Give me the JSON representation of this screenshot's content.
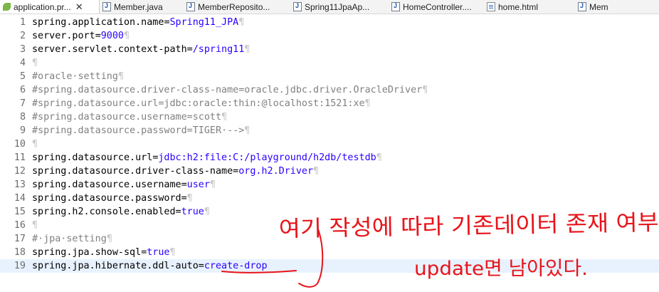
{
  "tabs": [
    {
      "label": "application.pr...",
      "icon": "properties-file-icon",
      "active": true,
      "close": "✕"
    },
    {
      "label": "Member.java",
      "icon": "java-file-icon"
    },
    {
      "label": "MemberReposito...",
      "icon": "java-file-icon"
    },
    {
      "label": "Spring11JpaAp...",
      "icon": "java-file-icon"
    },
    {
      "label": "HomeController....",
      "icon": "java-file-icon"
    },
    {
      "label": "home.html",
      "icon": "html-file-icon"
    },
    {
      "label": "Mem",
      "icon": "java-file-icon"
    }
  ],
  "lines": [
    {
      "n": "1",
      "parts": [
        {
          "t": "spring.application.name",
          "s": "k"
        },
        {
          "t": "=",
          "s": "eq"
        },
        {
          "t": "Spring11_JPA",
          "s": "v"
        },
        {
          "t": "¶",
          "s": "pil"
        }
      ]
    },
    {
      "n": "2",
      "parts": [
        {
          "t": "server.port",
          "s": "k"
        },
        {
          "t": "=",
          "s": "eq"
        },
        {
          "t": "9000",
          "s": "v"
        },
        {
          "t": "¶",
          "s": "pil"
        }
      ]
    },
    {
      "n": "3",
      "parts": [
        {
          "t": "server.servlet.context-path",
          "s": "k"
        },
        {
          "t": "=",
          "s": "eq"
        },
        {
          "t": "/spring11",
          "s": "v"
        },
        {
          "t": "¶",
          "s": "pil"
        }
      ]
    },
    {
      "n": "4",
      "parts": [
        {
          "t": "¶",
          "s": "pil"
        }
      ]
    },
    {
      "n": "5",
      "parts": [
        {
          "t": "#oracle·setting",
          "s": "c"
        },
        {
          "t": "¶",
          "s": "pil"
        }
      ]
    },
    {
      "n": "6",
      "parts": [
        {
          "t": "#spring.datasource.driver-class-name=oracle.jdbc.driver.OracleDriver",
          "s": "c"
        },
        {
          "t": "¶",
          "s": "pil"
        }
      ]
    },
    {
      "n": "7",
      "parts": [
        {
          "t": "#spring.datasource.url=jdbc:oracle:thin:@localhost:1521:xe",
          "s": "c"
        },
        {
          "t": "¶",
          "s": "pil"
        }
      ]
    },
    {
      "n": "8",
      "parts": [
        {
          "t": "#spring.datasource.username=scott",
          "s": "c"
        },
        {
          "t": "¶",
          "s": "pil"
        }
      ]
    },
    {
      "n": "9",
      "parts": [
        {
          "t": "#spring.datasource.password=TIGER·-->",
          "s": "c"
        },
        {
          "t": "¶",
          "s": "pil"
        }
      ]
    },
    {
      "n": "10",
      "parts": [
        {
          "t": "¶",
          "s": "pil"
        }
      ]
    },
    {
      "n": "11",
      "parts": [
        {
          "t": "spring.datasource.url",
          "s": "k"
        },
        {
          "t": "=",
          "s": "eq"
        },
        {
          "t": "jdbc:h2:file:C:/playground/h2db/testdb",
          "s": "v"
        },
        {
          "t": "¶",
          "s": "pil"
        }
      ]
    },
    {
      "n": "12",
      "parts": [
        {
          "t": "spring.datasource.driver-class-name",
          "s": "k"
        },
        {
          "t": "=",
          "s": "eq"
        },
        {
          "t": "org.h2.Driver",
          "s": "v"
        },
        {
          "t": "¶",
          "s": "pil"
        }
      ]
    },
    {
      "n": "13",
      "parts": [
        {
          "t": "spring.datasource.username",
          "s": "k"
        },
        {
          "t": "=",
          "s": "eq"
        },
        {
          "t": "user",
          "s": "v"
        },
        {
          "t": "¶",
          "s": "pil"
        }
      ]
    },
    {
      "n": "14",
      "parts": [
        {
          "t": "spring.datasource.password",
          "s": "k"
        },
        {
          "t": "=",
          "s": "eq"
        },
        {
          "t": "¶",
          "s": "pil"
        }
      ]
    },
    {
      "n": "15",
      "parts": [
        {
          "t": "spring.h2.console.enabled",
          "s": "k"
        },
        {
          "t": "=",
          "s": "eq"
        },
        {
          "t": "true",
          "s": "v"
        },
        {
          "t": "¶",
          "s": "pil"
        }
      ]
    },
    {
      "n": "16",
      "parts": [
        {
          "t": "¶",
          "s": "pil"
        }
      ]
    },
    {
      "n": "17",
      "parts": [
        {
          "t": "#·jpa·setting",
          "s": "c"
        },
        {
          "t": "¶",
          "s": "pil"
        }
      ]
    },
    {
      "n": "18",
      "parts": [
        {
          "t": "spring.jpa.show-sql",
          "s": "k"
        },
        {
          "t": "=",
          "s": "eq"
        },
        {
          "t": "true",
          "s": "v"
        },
        {
          "t": "¶",
          "s": "pil"
        }
      ]
    },
    {
      "n": "19",
      "parts": [
        {
          "t": "spring.jpa.hibernate.ddl-auto",
          "s": "k"
        },
        {
          "t": "=",
          "s": "eq"
        },
        {
          "t": "create-drop",
          "s": "v"
        }
      ],
      "current": true
    }
  ],
  "annotation": {
    "line1": "여기 작성에 따라 기존데이터 존재 여부",
    "line2": "update면 남아있다.",
    "color": "#e8141a"
  }
}
